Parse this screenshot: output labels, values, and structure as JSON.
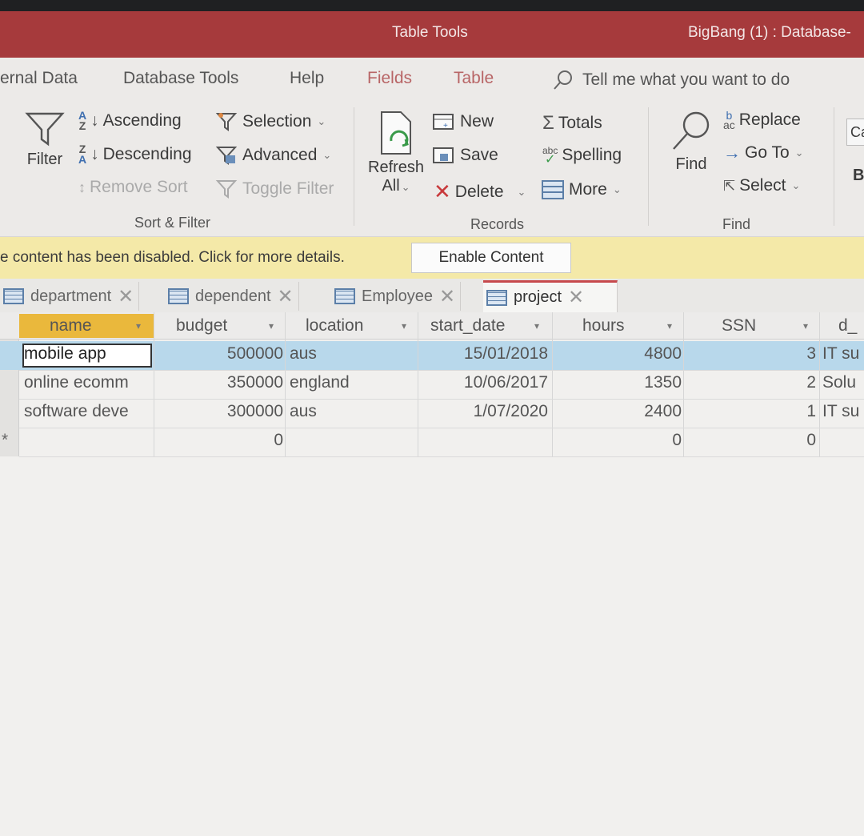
{
  "window": {
    "context_title": "Table Tools",
    "doc_title": "BigBang (1) : Database-"
  },
  "ribbon_tabs": [
    {
      "label": "ernal Data"
    },
    {
      "label": "Database Tools"
    },
    {
      "label": "Help"
    },
    {
      "label": "Fields"
    },
    {
      "label": "Table"
    }
  ],
  "tell_me": "Tell me what you want to do",
  "sort_filter": {
    "filter": "Filter",
    "ascending": "Ascending",
    "descending": "Descending",
    "remove_sort": "Remove Sort",
    "selection": "Selection",
    "advanced": "Advanced",
    "toggle_filter": "Toggle Filter",
    "group": "Sort & Filter"
  },
  "records": {
    "refresh": "Refresh",
    "all": "All",
    "new": "New",
    "save": "Save",
    "delete": "Delete",
    "totals": "Totals",
    "spelling": "Spelling",
    "more": "More",
    "group": "Records"
  },
  "find": {
    "find": "Find",
    "replace": "Replace",
    "goto": "Go To",
    "select": "Select",
    "group": "Find",
    "cut_c": "Ca",
    "cut_b": "B"
  },
  "message_bar": {
    "text": "e content has been disabled. Click for more details.",
    "button": "Enable Content"
  },
  "doc_tabs": [
    {
      "label": "department"
    },
    {
      "label": "dependent"
    },
    {
      "label": "Employee"
    },
    {
      "label": "project"
    }
  ],
  "table": {
    "columns": [
      "name",
      "budget",
      "location",
      "start_date",
      "hours",
      "SSN",
      "d_"
    ],
    "rows": [
      {
        "name": "mobile app",
        "budget": "500000",
        "location": "aus",
        "start_date": "15/01/2018",
        "hours": "4800",
        "ssn": "3",
        "d": "IT su"
      },
      {
        "name": "online ecomm",
        "budget": "350000",
        "location": "england",
        "start_date": "10/06/2017",
        "hours": "1350",
        "ssn": "2",
        "d": "Solu"
      },
      {
        "name": "software deve",
        "budget": "300000",
        "location": "aus",
        "start_date": "1/07/2020",
        "hours": "2400",
        "ssn": "1",
        "d": "IT su"
      }
    ],
    "new_row": {
      "marker": "*",
      "budget": "0",
      "hours": "0",
      "ssn": "0"
    }
  },
  "colors": {
    "title_bar": "#a63a3c",
    "selected_row": "#b8d8eb",
    "message_bar": "#f4e9a8",
    "active_tab_accent": "#c6494c"
  }
}
